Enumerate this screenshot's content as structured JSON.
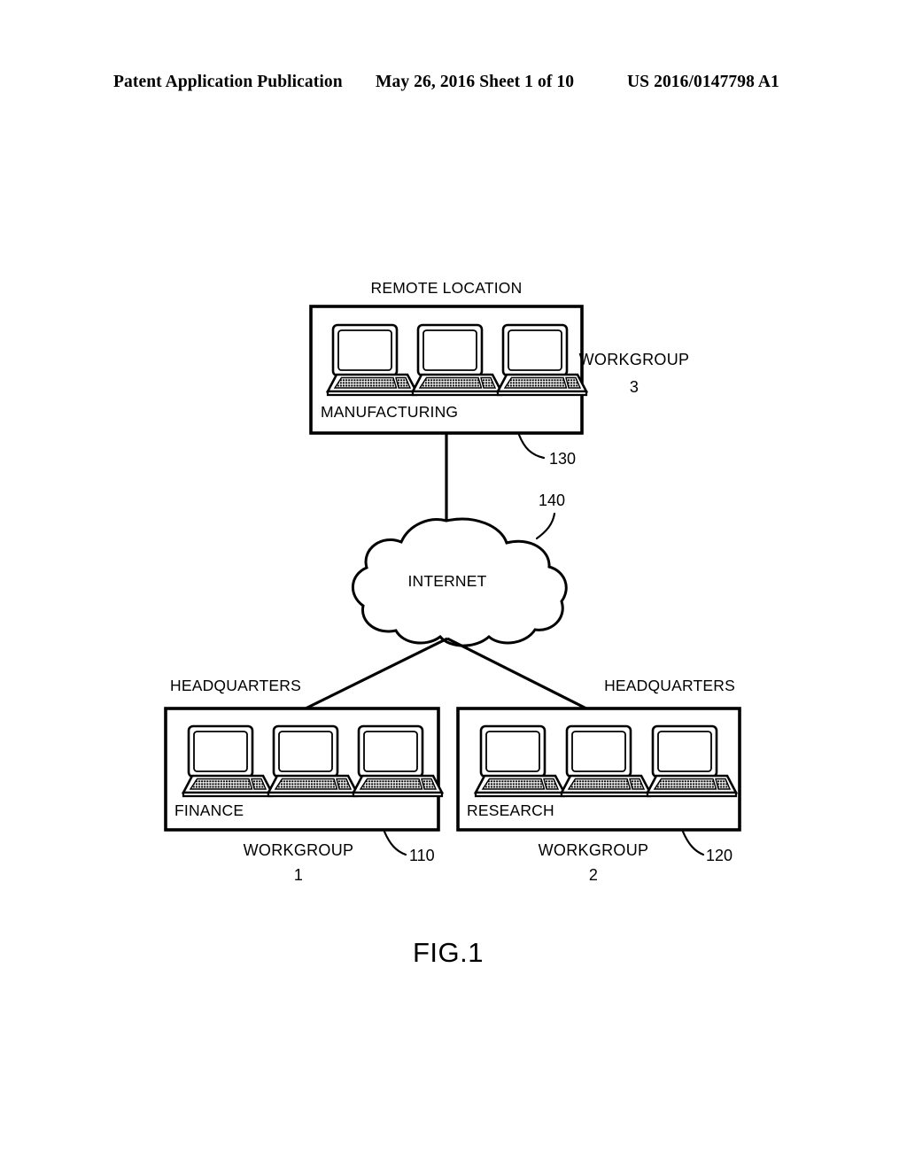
{
  "header": {
    "left": "Patent Application Publication",
    "middle": "May 26, 2016  Sheet 1 of 10",
    "right": "US 2016/0147798 A1"
  },
  "figure": {
    "caption": "FIG.1",
    "cloud": {
      "label": "INTERNET",
      "ref": "140"
    },
    "sites": [
      {
        "id": "remote-location",
        "site_label": "REMOTE LOCATION",
        "site_label_position": "top-center",
        "department": "MANUFACTURING",
        "workgroup_label": "WORKGROUP",
        "workgroup_number": "3",
        "workgroup_position": "right",
        "ref": "130",
        "laptop_count": 3
      },
      {
        "id": "headquarters-finance",
        "site_label": "HEADQUARTERS",
        "site_label_position": "top-left",
        "department": "FINANCE",
        "workgroup_label": "WORKGROUP",
        "workgroup_number": "1",
        "workgroup_position": "bottom",
        "ref": "110",
        "laptop_count": 3
      },
      {
        "id": "headquarters-research",
        "site_label": "HEADQUARTERS",
        "site_label_position": "top-right",
        "department": "RESEARCH",
        "workgroup_label": "WORKGROUP",
        "workgroup_number": "2",
        "workgroup_position": "bottom",
        "ref": "120",
        "laptop_count": 3
      }
    ],
    "connections": [
      {
        "from": "remote-location",
        "to": "cloud"
      },
      {
        "from": "cloud",
        "to": "headquarters-finance"
      },
      {
        "from": "cloud",
        "to": "headquarters-research"
      }
    ],
    "colors": {
      "ink": "#000000",
      "paper": "#ffffff"
    }
  }
}
